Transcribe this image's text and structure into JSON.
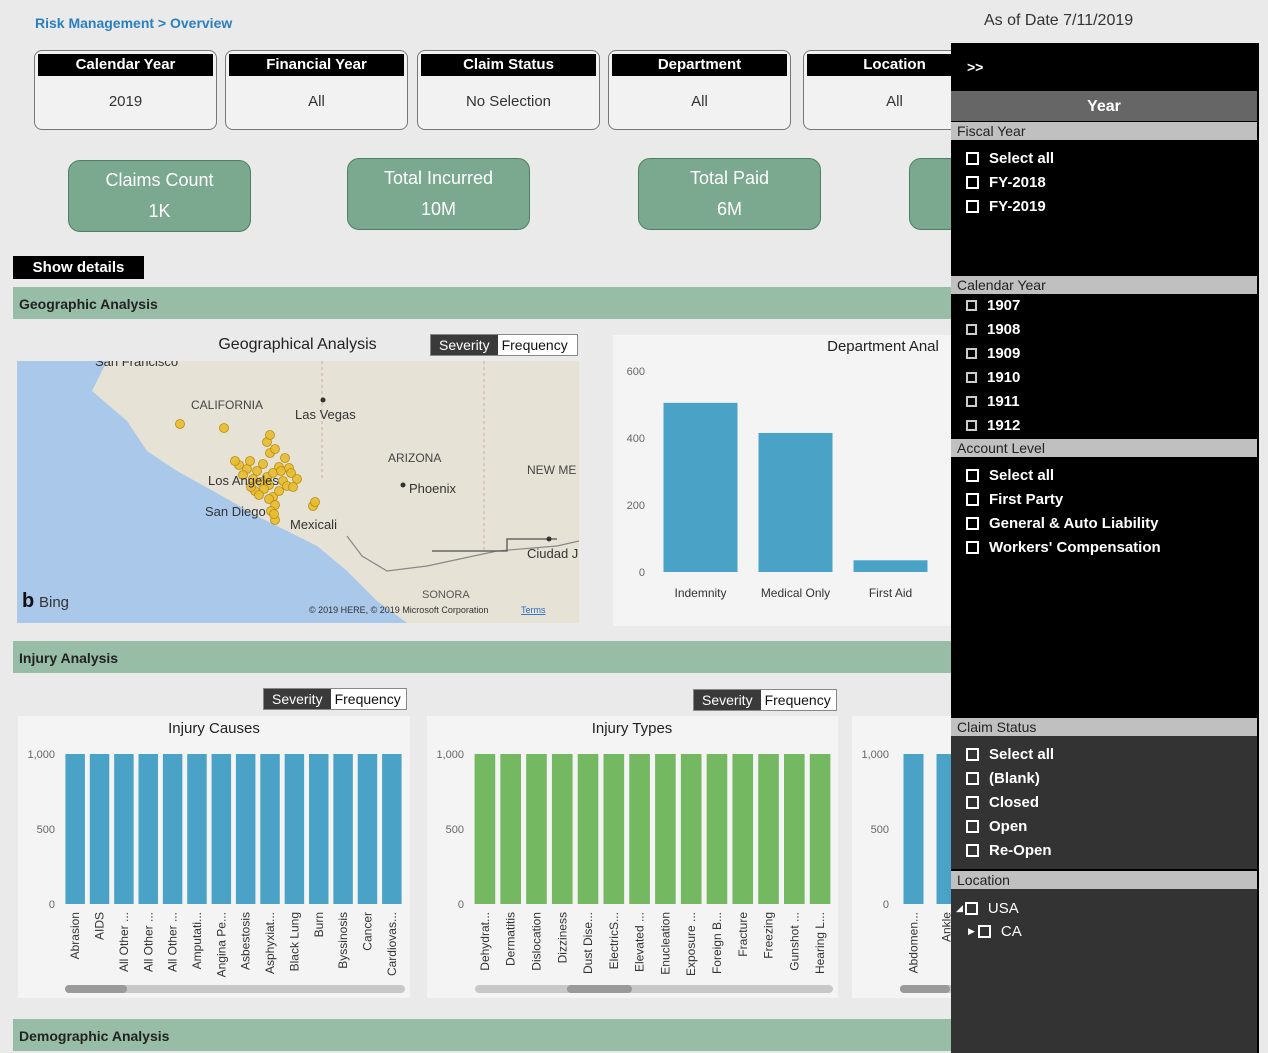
{
  "breadcrumb": "Risk Management > Overview",
  "as_of": "As of Date 7/11/2019",
  "slicers": [
    {
      "title": "Calendar Year",
      "value": "2019"
    },
    {
      "title": "Financial Year",
      "value": "All"
    },
    {
      "title": "Claim Status",
      "value": "No Selection"
    },
    {
      "title": "Department",
      "value": "All"
    },
    {
      "title": "Location",
      "value": "All"
    }
  ],
  "kpis": [
    {
      "title": "Claims Count",
      "value": "1K"
    },
    {
      "title": "Total Incurred",
      "value": "10M"
    },
    {
      "title": "Total Paid",
      "value": "6M"
    }
  ],
  "show_details": "Show details",
  "sections": {
    "geographic": "Geographic Analysis",
    "injury": "Injury Analysis",
    "demographic": "Demographic Analysis"
  },
  "toggle": {
    "severity": "Severity",
    "frequency": "Frequency"
  },
  "geo": {
    "title": "Geographical Analysis",
    "places": [
      "San Francisco",
      "CALIFORNIA",
      "Las Vegas",
      "ARIZONA",
      "NEW ME",
      "Phoenix",
      "Los Angeles",
      "San Diego",
      "Mexicali",
      "Ciudad Juárez",
      "SONORA"
    ],
    "bing": "Bing",
    "credit": "© 2019 HERE, © 2019 Microsoft Corporation",
    "terms": "Terms"
  },
  "colors": {
    "accent_blue": "#4aa3c7",
    "accent_green": "#75b862",
    "kpi": "#7aa98f",
    "section": "#97bda7"
  },
  "chart_data": [
    {
      "type": "bar",
      "title": "Department Anal",
      "categories": [
        "Indemnity",
        "Medical Only",
        "First Aid"
      ],
      "values": [
        505,
        415,
        35
      ],
      "ylim": [
        0,
        600
      ],
      "yticks": [
        "0",
        "200",
        "400",
        "600"
      ]
    },
    {
      "type": "bar",
      "title": "Injury Causes",
      "categories": [
        "Abrasion",
        "AIDS",
        "All Other ...",
        "All Other ...",
        "All Other ...",
        "Amputati...",
        "Angina Pe...",
        "Asbestosis",
        "Asphyxiat...",
        "Black Lung",
        "Burn",
        "Byssinosis",
        "Cancer",
        "Cardiovas..."
      ],
      "values": [
        1000,
        1000,
        1000,
        1000,
        1000,
        1000,
        1000,
        1000,
        1000,
        1000,
        1000,
        1000,
        1000,
        1000
      ],
      "ylim": [
        0,
        1000
      ],
      "yticks": [
        "0",
        "500",
        "1,000"
      ]
    },
    {
      "type": "bar",
      "title": "Injury Types",
      "categories": [
        "Dehydrat...",
        "Dermatitis",
        "Dislocation",
        "Dizziness",
        "Dust Dise...",
        "ElectricS...",
        "Elevated ...",
        "Enucleation",
        "Exposure ...",
        "Foreign B...",
        "Fracture",
        "Freezing",
        "Gunshot ...",
        "Hearing L..."
      ],
      "values": [
        1000,
        1000,
        1000,
        1000,
        1000,
        1000,
        1000,
        1000,
        1000,
        1000,
        1000,
        1000,
        1000,
        1000
      ],
      "ylim": [
        0,
        1000
      ],
      "yticks": [
        "0",
        "500",
        "1,000"
      ]
    },
    {
      "type": "bar",
      "title": "",
      "categories": [
        "Abdomen...",
        "Ankle"
      ],
      "values": [
        1000,
        1000
      ],
      "ylim": [
        0,
        1000
      ],
      "yticks": [
        "0",
        "500",
        "1,000"
      ]
    }
  ],
  "side_panel": {
    "expand": ">>",
    "year_header": "Year",
    "fiscal_year": {
      "header": "Fiscal Year",
      "options": [
        "Select all",
        "FY-2018",
        "FY-2019"
      ]
    },
    "calendar_year": {
      "header": "Calendar Year",
      "options": [
        "1907",
        "1908",
        "1909",
        "1910",
        "1911",
        "1912"
      ]
    },
    "account_level": {
      "header": "Account Level",
      "options": [
        "Select all",
        "First Party",
        "General & Auto Liability",
        "Workers' Compensation"
      ]
    },
    "claim_status": {
      "header": "Claim Status",
      "options": [
        "Select all",
        "(Blank)",
        "Closed",
        "Open",
        "Re-Open"
      ]
    },
    "location": {
      "header": "Location",
      "options": [
        "USA",
        "CA"
      ]
    }
  }
}
